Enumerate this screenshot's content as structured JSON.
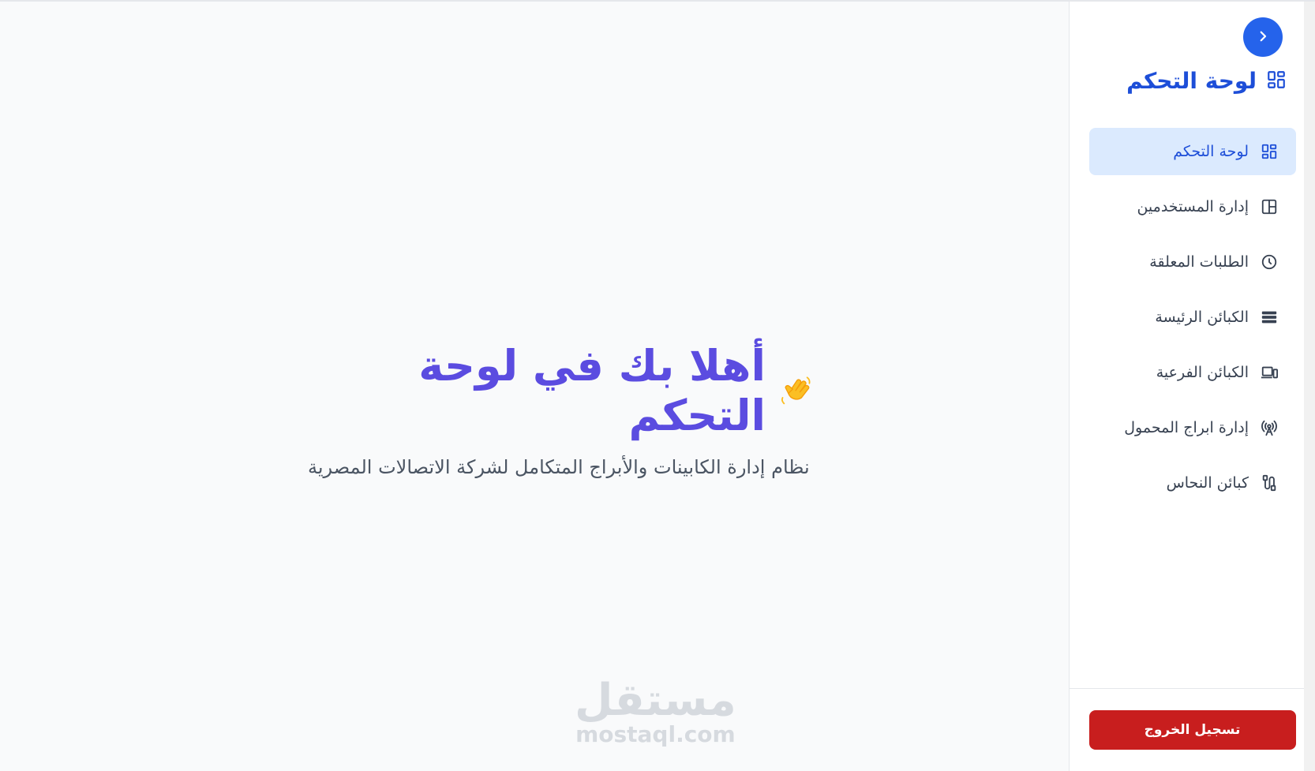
{
  "sidebar": {
    "brand_title": "لوحة التحكم",
    "brand_icon": "dashboard-grid-icon",
    "collapse_icon": "chevron-right-icon",
    "items": [
      {
        "label": "لوحة التحكم",
        "icon": "dashboard-grid-icon",
        "active": true
      },
      {
        "label": "إدارة المستخدمين",
        "icon": "layout-panel-icon",
        "active": false
      },
      {
        "label": "الطلبات المعلقة",
        "icon": "clock-icon",
        "active": false
      },
      {
        "label": "الكبائن الرئيسة",
        "icon": "server-rack-icon",
        "active": false
      },
      {
        "label": "الكبائن الفرعية",
        "icon": "devices-icon",
        "active": false
      },
      {
        "label": "إدارة ابراج المحمول",
        "icon": "antenna-tower-icon",
        "active": false
      },
      {
        "label": "كبائن النحاس",
        "icon": "cable-icon",
        "active": false
      }
    ],
    "logout_label": "تسجيل الخروج"
  },
  "main": {
    "hero_title": "أهلا بك في لوحة التحكم",
    "hero_icon": "waving-hand-icon",
    "hero_subtitle": "نظام إدارة الكابينات والأبراج المتكامل لشركة الاتصالات المصرية"
  },
  "watermark": {
    "arabic": "مستقل",
    "latin": "mostaql.com"
  },
  "colors": {
    "accent": "#2563eb",
    "active_bg": "#dbeafe",
    "hero_title": "#5b4ce0",
    "logout": "#c81e1e"
  }
}
